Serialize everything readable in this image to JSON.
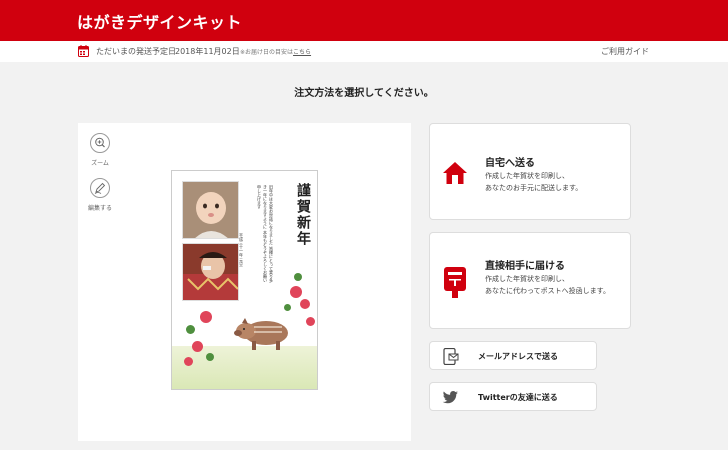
{
  "header": {
    "title": "はがきデザインキット"
  },
  "info_bar": {
    "shipping_label": "ただいまの発送予定日",
    "shipping_date": "2018年11月02日",
    "shipping_note_prefix": "※お届け日の目安は",
    "shipping_note_link": "こちら",
    "guide_link": "ご利用ガイド"
  },
  "main": {
    "heading": "注文方法を選択してください。"
  },
  "preview": {
    "tools": [
      {
        "label": "ズーム",
        "icon": "zoom-in-icon"
      },
      {
        "label": "編集する",
        "icon": "edit-pen-icon"
      }
    ],
    "card": {
      "title": "謹賀新年",
      "message": "旧年中は大変お世話になりました 皆様にとって実り多き一年になりますように 本年もどうぞよろしくお願い申し上げます",
      "date": "平成三十一年 元旦"
    }
  },
  "options": [
    {
      "title": "自宅へ送る",
      "desc_line1": "作成した年賀状を印刷し、",
      "desc_line2": "あなたのお手元に配送します。",
      "icon": "house-icon"
    },
    {
      "title": "直接相手に届ける",
      "desc_line1": "作成した年賀状を印刷し、",
      "desc_line2": "あなたに代わってポストへ投函します。",
      "icon": "mailbox-icon"
    }
  ],
  "share_options": [
    {
      "label": "メールアドレスで送る",
      "icon": "mail-phone-icon"
    },
    {
      "label": "Twitterの友達に送る",
      "icon": "twitter-bird-icon"
    }
  ],
  "colors": {
    "brand_red": "#d0000e",
    "background": "#f2f2f2"
  }
}
